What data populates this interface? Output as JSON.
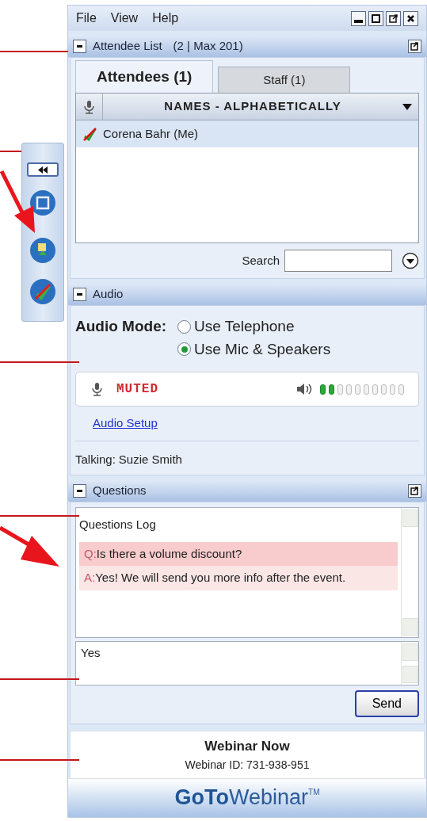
{
  "menu": [
    "File",
    "View",
    "Help"
  ],
  "attendee_list": {
    "title": "Attendee List",
    "count": "(2 | Max 201)",
    "tabs": [
      {
        "label": "Attendees (1)",
        "selected": true
      },
      {
        "label": "Staff (1)",
        "selected": false
      }
    ],
    "column": "NAMES - ALPHABETICALLY",
    "attendees": [
      {
        "name": "Corena Bahr (Me)",
        "muted": true,
        "selected": true
      }
    ],
    "search_label": "Search"
  },
  "audio": {
    "title": "Audio",
    "mode_label": "Audio Mode:",
    "options": [
      {
        "label": "Use Telephone",
        "selected": false
      },
      {
        "label": "Use Mic & Speakers",
        "selected": true
      }
    ],
    "mic_status": "MUTED",
    "speaker": {
      "level": 0.2
    },
    "setup_link": "Audio Setup",
    "talking_label": "Talking:",
    "talking_name": "Suzie Smith"
  },
  "questions": {
    "title": "Questions",
    "log_title": "Questions Log",
    "entries": [
      {
        "prefix": "Q:",
        "text": "Is there a volume discount?"
      },
      {
        "prefix": "A:",
        "text": "Yes! We will send you more info after the event."
      }
    ],
    "input_value": "Yes",
    "send": "Send"
  },
  "footer": {
    "title": "Webinar Now",
    "webinar_id": "Webinar ID: 731-938-951"
  },
  "logo": {
    "bold": "GoTo",
    "light": "Webinar",
    "mark": "TM"
  }
}
